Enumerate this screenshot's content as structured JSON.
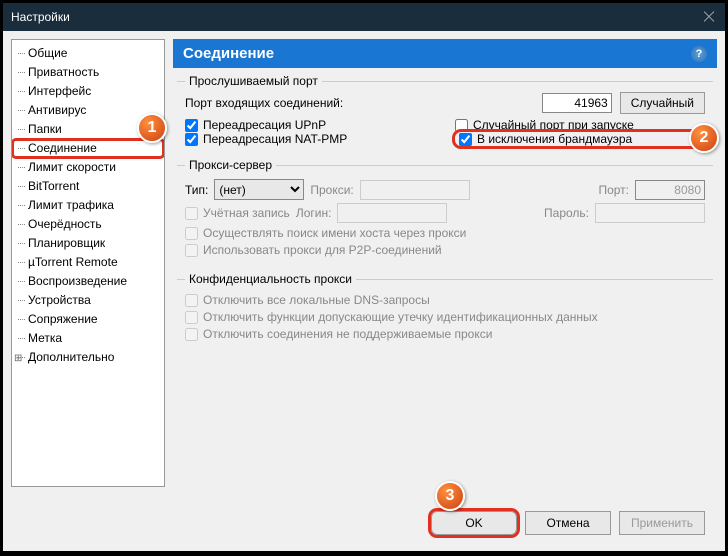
{
  "window": {
    "title": "Настройки"
  },
  "sidebar": {
    "items": [
      {
        "label": "Общие"
      },
      {
        "label": "Приватность"
      },
      {
        "label": "Интерфейс"
      },
      {
        "label": "Антивирус"
      },
      {
        "label": "Папки"
      },
      {
        "label": "Соединение",
        "selected": true
      },
      {
        "label": "Лимит скорости"
      },
      {
        "label": "BitTorrent"
      },
      {
        "label": "Лимит трафика"
      },
      {
        "label": "Очерёдность"
      },
      {
        "label": "Планировщик"
      },
      {
        "label": "µTorrent Remote"
      },
      {
        "label": "Воспроизведение"
      },
      {
        "label": "Устройства"
      },
      {
        "label": "Сопряжение"
      },
      {
        "label": "Метка"
      },
      {
        "label": "Дополнительно",
        "expandable": true
      }
    ]
  },
  "header": {
    "title": "Соединение"
  },
  "listen": {
    "legend": "Прослушиваемый порт",
    "port_label": "Порт входящих соединений:",
    "port_value": "41963",
    "random_button": "Случайный",
    "upnp": "Переадресация UPnP",
    "natpmp": "Переадресация NAT-PMP",
    "random_start": "Случайный порт при запуске",
    "firewall": "В исключения брандмауэра"
  },
  "proxy": {
    "legend": "Прокси-сервер",
    "type_label": "Тип:",
    "type_value": "(нет)",
    "proxy_label": "Прокси:",
    "port_label": "Порт:",
    "port_value": "8080",
    "auth": "Учётная запись",
    "login_label": "Логин:",
    "pass_label": "Пароль:",
    "hostname": "Осуществлять поиск имени хоста через прокси",
    "p2p": "Использовать прокси для P2P-соединений"
  },
  "privacy": {
    "legend": "Конфиденциальность прокси",
    "dns": "Отключить все локальные DNS-запросы",
    "leak": "Отключить функции допускающие утечку идентификационных данных",
    "unsupported": "Отключить соединения не поддерживаемые прокси"
  },
  "footer": {
    "ok": "OK",
    "cancel": "Отмена",
    "apply": "Применить"
  },
  "callouts": {
    "c1": "1",
    "c2": "2",
    "c3": "3"
  }
}
